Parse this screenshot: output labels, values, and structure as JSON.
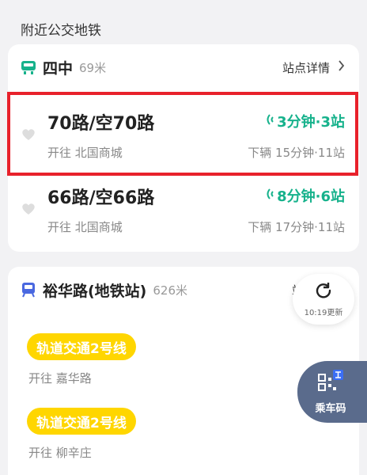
{
  "section_title": "附近公交地铁",
  "bus_stop": {
    "name": "四中",
    "distance": "69米",
    "detail_label": "站点详情",
    "routes": [
      {
        "name": "70路/空70路",
        "direction": "开往 北国商城",
        "eta": "3分钟·3站",
        "next": "下辆 15分钟·11站"
      },
      {
        "name": "66路/空66路",
        "direction": "开往 北国商城",
        "eta": "8分钟·6站",
        "next": "下辆 17分钟·11站"
      }
    ]
  },
  "metro_stop": {
    "name": "裕华路(地铁站)",
    "distance": "626米",
    "detail_label": "站",
    "lines": [
      {
        "name": "轨道交通2号线",
        "direction": "开往 嘉华路"
      },
      {
        "name": "轨道交通2号线",
        "direction": "开往 柳辛庄"
      }
    ]
  },
  "refresh": {
    "time_label": "10:19更新"
  },
  "ride_code": {
    "label": "乘车码"
  },
  "colors": {
    "accent_green": "#17b28c",
    "highlight_red": "#e8212b",
    "metro_yellow": "#ffd600"
  }
}
